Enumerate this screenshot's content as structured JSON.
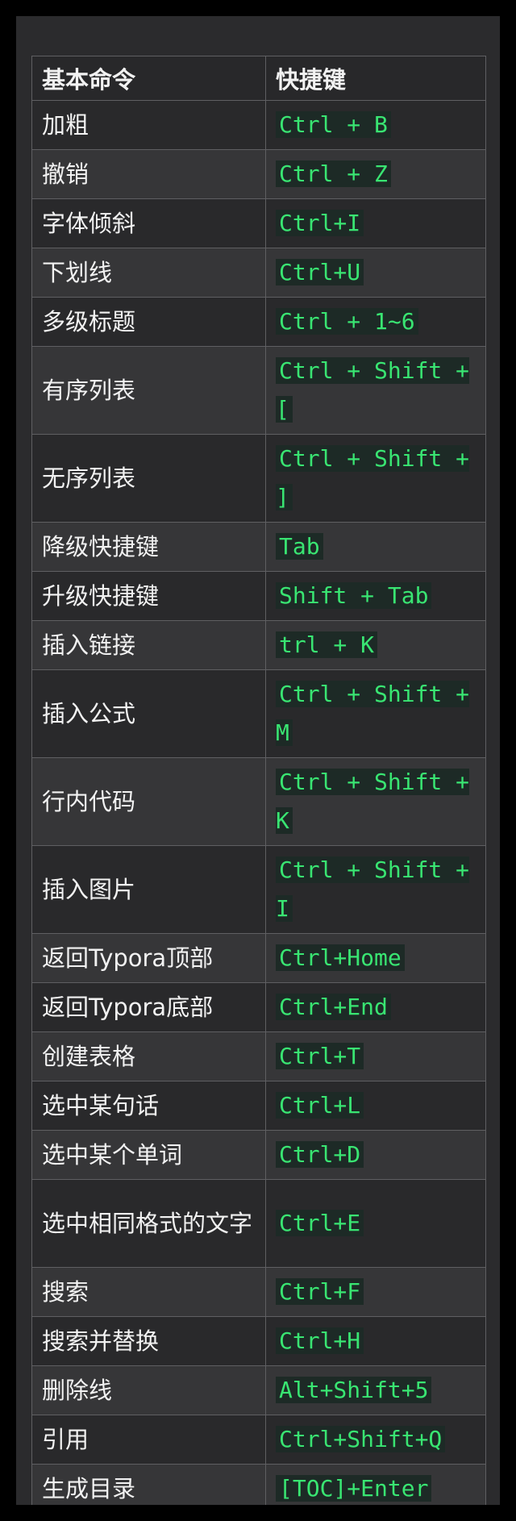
{
  "table": {
    "header": {
      "command": "基本命令",
      "shortcut": "快捷键"
    },
    "rows": [
      {
        "command": "加粗",
        "shortcut": "Ctrl + B"
      },
      {
        "command": "撤销",
        "shortcut": "Ctrl + Z"
      },
      {
        "command": "字体倾斜",
        "shortcut": "Ctrl+I"
      },
      {
        "command": "下划线",
        "shortcut": "Ctrl+U"
      },
      {
        "command": "多级标题",
        "shortcut": "Ctrl + 1~6"
      },
      {
        "command": "有序列表",
        "shortcut": "Ctrl + Shift + ["
      },
      {
        "command": "无序列表",
        "shortcut": "Ctrl + Shift + ]"
      },
      {
        "command": "降级快捷键",
        "shortcut": "Tab"
      },
      {
        "command": "升级快捷键",
        "shortcut": "Shift + Tab"
      },
      {
        "command": "插入链接",
        "shortcut": "trl + K"
      },
      {
        "command": "插入公式",
        "shortcut": "Ctrl + Shift + M"
      },
      {
        "command": "行内代码",
        "shortcut": "Ctrl + Shift + K"
      },
      {
        "command": "插入图片",
        "shortcut": "Ctrl + Shift + I"
      },
      {
        "command": "返回Typora顶部",
        "shortcut": "Ctrl+Home"
      },
      {
        "command": "返回Typora底部",
        "shortcut": "Ctrl+End"
      },
      {
        "command": "创建表格",
        "shortcut": "Ctrl+T"
      },
      {
        "command": "选中某句话",
        "shortcut": "Ctrl+L"
      },
      {
        "command": "选中某个单词",
        "shortcut": "Ctrl+D"
      },
      {
        "command": "选中相同格式的文字",
        "shortcut": "Ctrl+E"
      },
      {
        "command": "搜索",
        "shortcut": "Ctrl+F"
      },
      {
        "command": "搜索并替换",
        "shortcut": "Ctrl+H"
      },
      {
        "command": "删除线",
        "shortcut": "Alt+Shift+5"
      },
      {
        "command": "引用",
        "shortcut": "Ctrl+Shift+Q"
      },
      {
        "command": "生成目录",
        "shortcut": "[TOC]+Enter"
      }
    ]
  },
  "colors": {
    "page_background": "#000000",
    "panel_background": "#2b2b2d",
    "row_odd": "#29292b",
    "row_even": "#363638",
    "border": "#5f5f62",
    "text": "#f2f2f2",
    "code_text": "#39e572",
    "code_background": "#1d2a26"
  }
}
